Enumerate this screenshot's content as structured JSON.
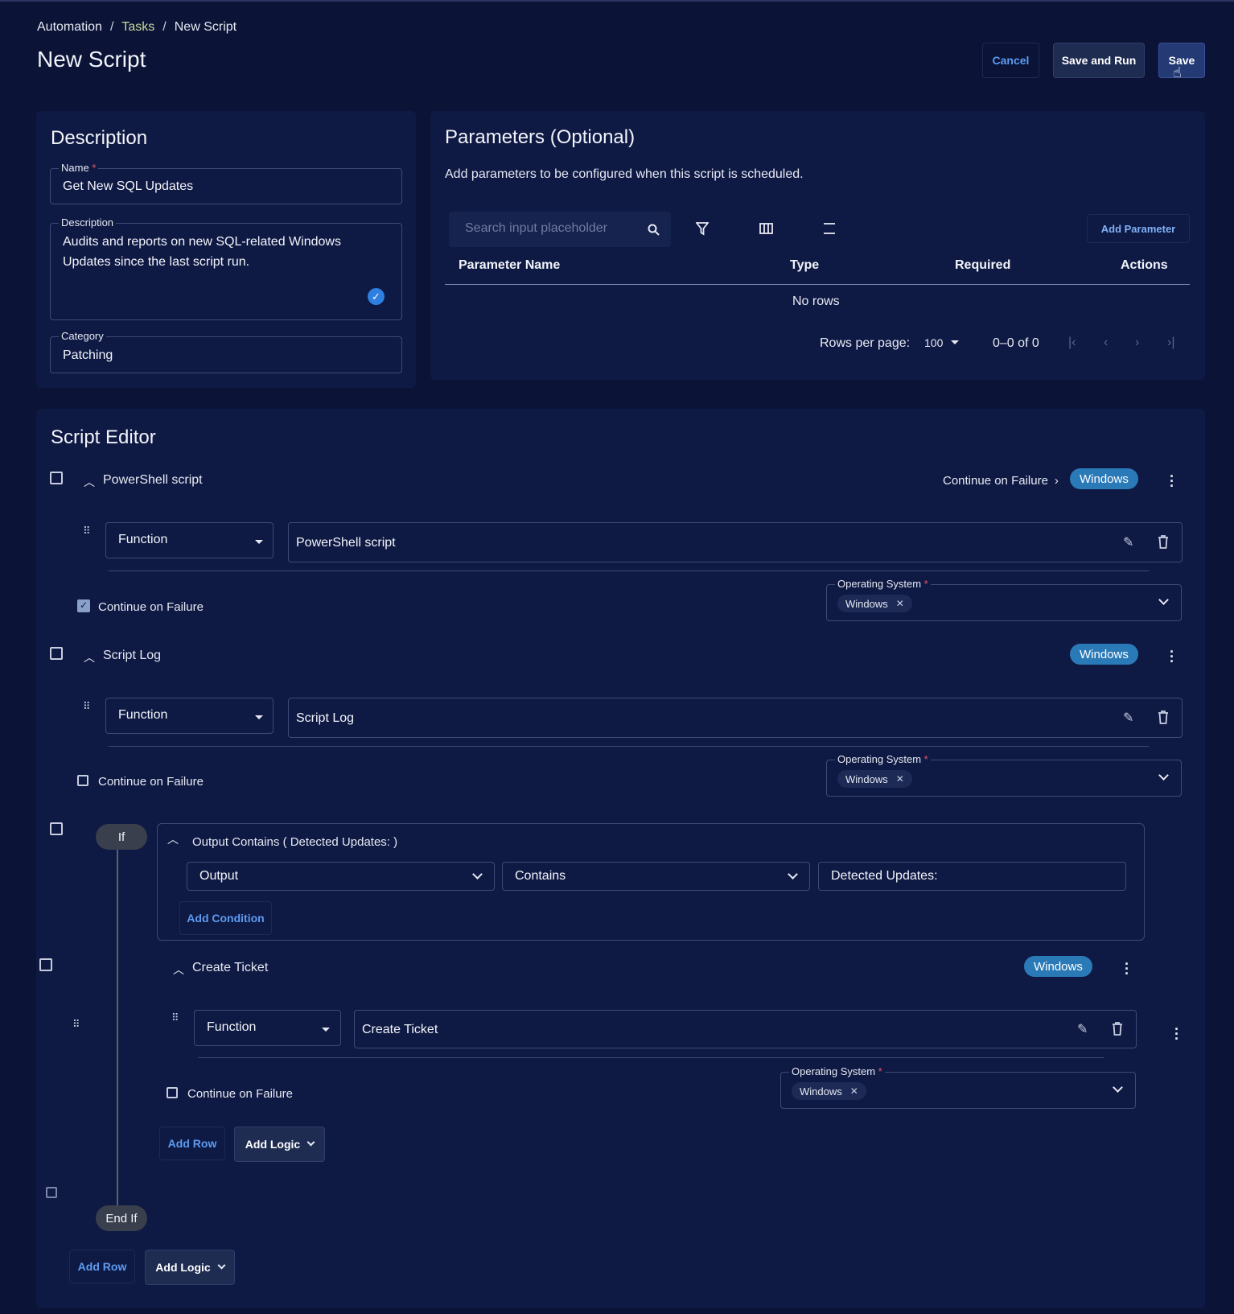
{
  "breadcrumb": {
    "root": "Automation",
    "middle": "Tasks",
    "current": "New Script",
    "separator": "/"
  },
  "page_title": "New Script",
  "header_buttons": {
    "cancel": "Cancel",
    "save_and_run": "Save and Run",
    "save": "Save"
  },
  "description_panel": {
    "title": "Description",
    "name_label": "Name",
    "name_value": "Get New SQL Updates",
    "description_label": "Description",
    "description_value": "Audits and reports on new SQL-related Windows Updates since the last script run.",
    "category_label": "Category",
    "category_value": "Patching",
    "required_mark": "*"
  },
  "parameters_panel": {
    "title": "Parameters (Optional)",
    "subtitle": "Add parameters to be configured when this script is scheduled.",
    "search_placeholder": "Search input placeholder",
    "add_parameter": "Add Parameter",
    "columns": [
      "Parameter Name",
      "Type",
      "Required",
      "Actions"
    ],
    "empty_text": "No rows",
    "rows_per_page_label": "Rows per page:",
    "rows_per_page_value": "100",
    "range_text": "0–0 of 0"
  },
  "script_editor": {
    "title": "Script Editor",
    "steps": [
      {
        "title": "PowerShell script",
        "continue_link": "Continue on Failure",
        "os_pill": "Windows",
        "type_select": "Function",
        "function_value": "PowerShell script",
        "continue_label": "Continue on Failure",
        "continue_checked": true,
        "os_label": "Operating System",
        "os_chip": "Windows"
      },
      {
        "title": "Script Log",
        "os_pill": "Windows",
        "type_select": "Function",
        "function_value": "Script Log",
        "continue_label": "Continue on Failure",
        "continue_checked": false,
        "os_label": "Operating System",
        "os_chip": "Windows"
      }
    ],
    "if_block": {
      "if_label": "If",
      "end_if_label": "End If",
      "condition_title": "Output Contains ( Detected Updates: )",
      "field_select": "Output",
      "operator_select": "Contains",
      "value": "Detected Updates:",
      "add_condition": "Add Condition",
      "inner_step": {
        "title": "Create Ticket",
        "os_pill": "Windows",
        "type_select": "Function",
        "function_value": "Create Ticket",
        "continue_label": "Continue on Failure",
        "continue_checked": false,
        "os_label": "Operating System",
        "os_chip": "Windows"
      },
      "add_row": "Add Row",
      "add_logic": "Add Logic"
    },
    "add_row": "Add Row",
    "add_logic": "Add Logic"
  },
  "colors": {
    "background": "#0b1437",
    "panel": "#0f1a44",
    "accent": "#5d9bf0",
    "pill": "#2a7ab8"
  }
}
